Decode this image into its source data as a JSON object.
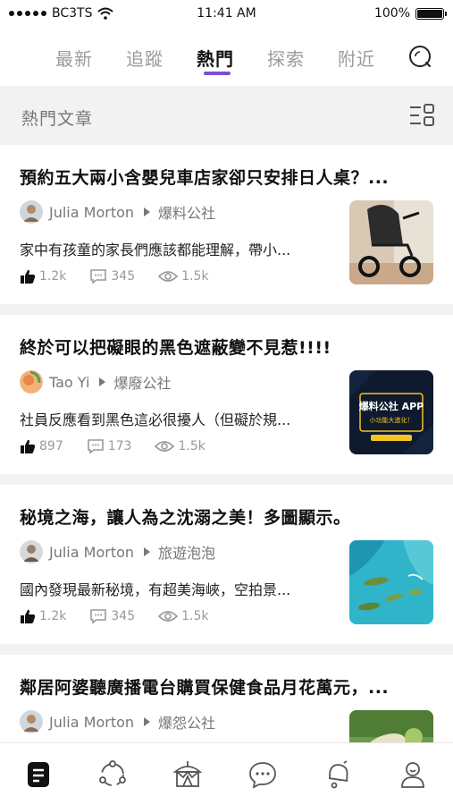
{
  "status_bar": {
    "carrier": "BC3TS",
    "time": "11:41 AM",
    "battery": "100%"
  },
  "tabs": [
    {
      "label": "最新"
    },
    {
      "label": "追蹤"
    },
    {
      "label": "熱門"
    },
    {
      "label": "探索"
    },
    {
      "label": "附近"
    }
  ],
  "active_tab": "熱門",
  "section": {
    "title": "熱門文章"
  },
  "articles": [
    {
      "title": "預約五大兩小含嬰兒車店家卻只安排日人桌？...",
      "author": "Julia Morton",
      "board": "爆料公社",
      "excerpt": "家中有孩童的家長們應該都能理解，帶小...",
      "likes": "1.2k",
      "comments": "345",
      "views": "1.5k",
      "thumbnail_icon": "stroller-photo"
    },
    {
      "title": "終於可以把礙眼的黑色遮蔽變不見惹!!!!",
      "author": "Tao Yi",
      "board": "爆廢公社",
      "excerpt": "社員反應看到黑色這必很擾人（但礙於規...",
      "likes": "897",
      "comments": "173",
      "views": "1.5k",
      "thumbnail_icon": "app-promo-graphic",
      "thumb_line1": "爆料公社 APP",
      "thumb_line2": "小功能大進化！"
    },
    {
      "title": "秘境之海，讓人為之沈溺之美！多圖顯示。",
      "author": "Julia Morton",
      "board": "旅遊泡泡",
      "excerpt": "國內發現最新秘境，有超美海峽，空拍景...",
      "likes": "1.2k",
      "comments": "345",
      "views": "1.5k",
      "thumbnail_icon": "sea-aerial-photo"
    },
    {
      "title": "鄰居阿婆聽廣播電台購買保健食品月花萬元，...",
      "author": "Julia Morton",
      "board": "爆怨公社",
      "thumbnail_icon": "food-photo"
    }
  ],
  "bottom_nav": [
    {
      "icon": "article-icon",
      "active": true
    },
    {
      "icon": "share-network-icon"
    },
    {
      "icon": "circus-tent-icon"
    },
    {
      "icon": "chat-icon"
    },
    {
      "icon": "notification-bell-icon"
    },
    {
      "icon": "profile-icon"
    }
  ],
  "colors": {
    "accent": "#7b4fd6",
    "text": "#111111",
    "muted": "#999999",
    "background": "#f2f2f2"
  }
}
